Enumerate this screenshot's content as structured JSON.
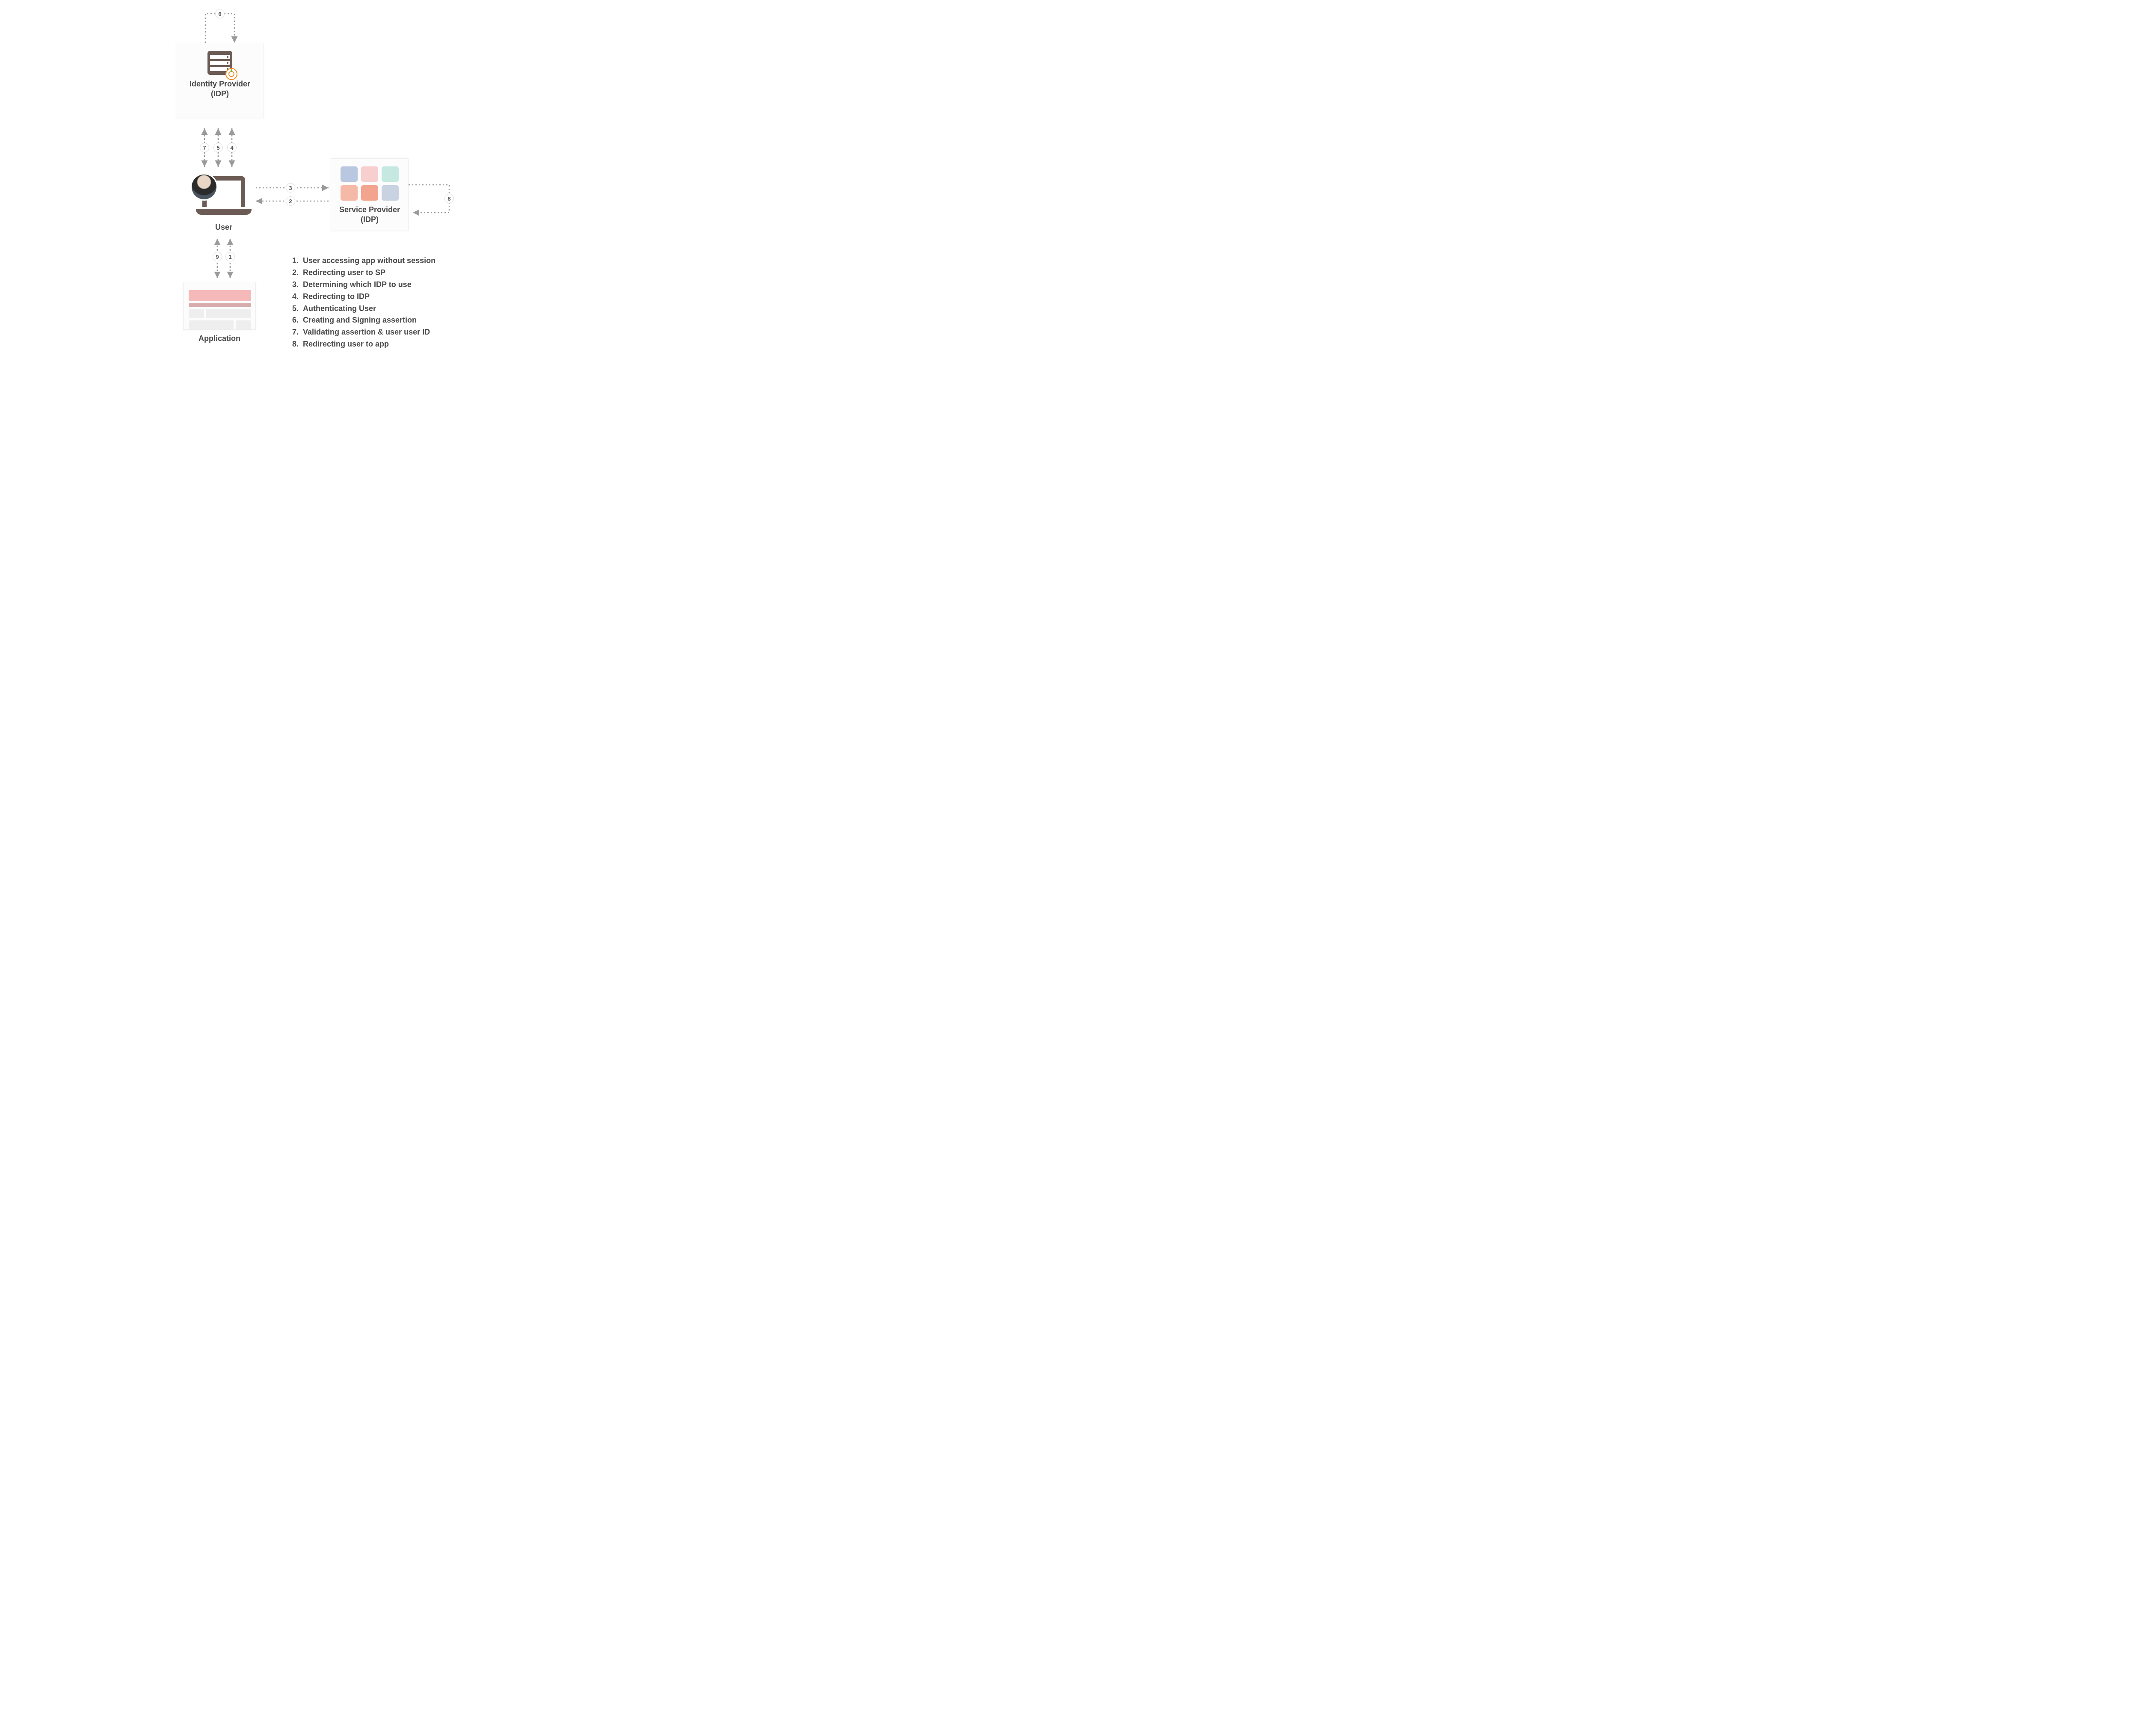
{
  "nodes": {
    "idp": {
      "title_line1": "Identity Provider",
      "title_line2": "(IDP)"
    },
    "sp": {
      "title_line1": "Service Provider",
      "title_line2": "(IDP)"
    },
    "user": {
      "label": "User"
    },
    "app": {
      "label": "Application"
    }
  },
  "steps": {
    "s1": "1",
    "s2": "2",
    "s3": "3",
    "s4": "4",
    "s5": "5",
    "s6": "6",
    "s7": "7",
    "s8": "8",
    "s9": "9"
  },
  "legend": {
    "items": [
      {
        "n": "1",
        "text": "User accessing app without session"
      },
      {
        "n": "2",
        "text": "Redirecting user to SP"
      },
      {
        "n": "3",
        "text": "Determining which IDP to use"
      },
      {
        "n": "4",
        "text": "Redirecting to IDP"
      },
      {
        "n": "5",
        "text": "Authenticating User"
      },
      {
        "n": "6",
        "text": "Creating and Signing assertion"
      },
      {
        "n": "7",
        "text": "Validating assertion & user user ID"
      },
      {
        "n": "8",
        "text": "Redirecting user to app"
      }
    ]
  }
}
